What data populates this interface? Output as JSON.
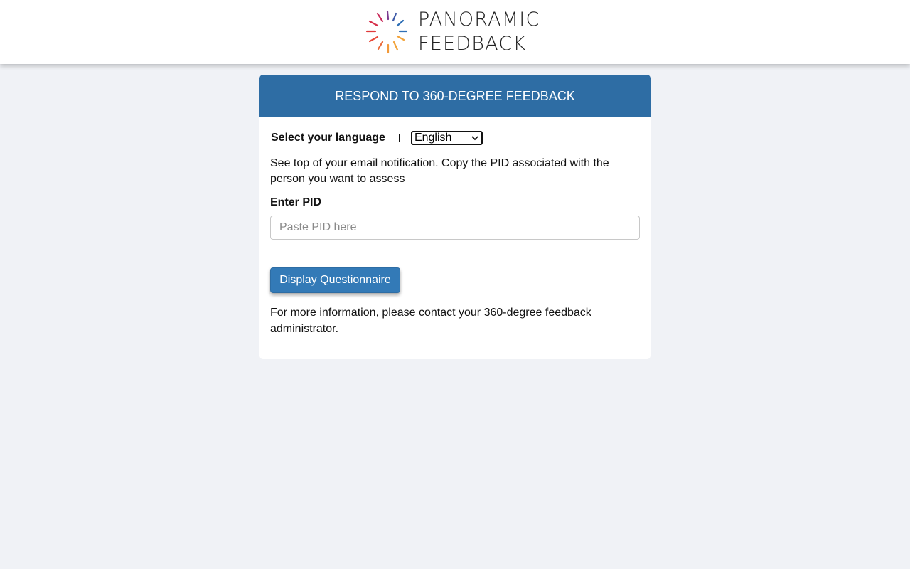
{
  "brand": {
    "line1": "PANORAMIC",
    "line2": "FEEDBACK",
    "logo_icon": "sunburst-logo-icon"
  },
  "card": {
    "title": "RESPOND TO 360-DEGREE FEEDBACK",
    "language": {
      "label": "Select your language",
      "icon": "globe-icon",
      "selected": "English"
    },
    "instructions": "See top of your email notification. Copy the PID associated with the person you want to assess",
    "pid": {
      "label": "Enter PID",
      "placeholder": "Paste PID here",
      "value": ""
    },
    "button_label": "Display Questionnaire",
    "more_info": "For more information, please contact your 360-degree feedback administrator."
  },
  "colors": {
    "header_blue": "#2e6da4",
    "button_blue": "#337ab7",
    "page_bg": "#f0f2f6"
  }
}
